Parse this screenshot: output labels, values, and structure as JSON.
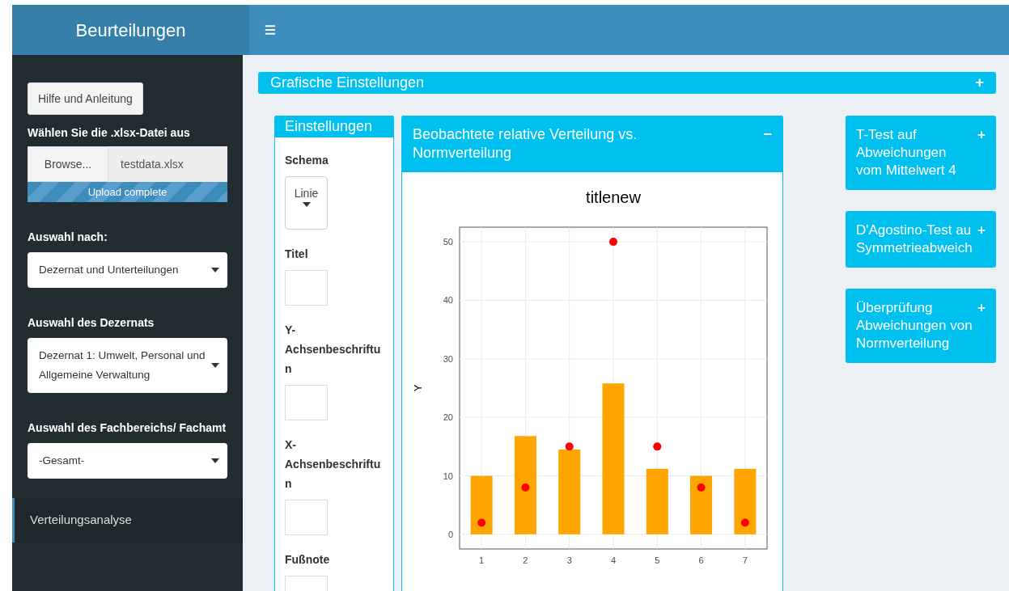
{
  "header": {
    "title": "Beurteilungen"
  },
  "sidebar": {
    "help_button": "Hilfe und Anleitung",
    "file_input": {
      "label": "Wählen Sie die .xlsx-Datei aus",
      "button": "Browse...",
      "value": "testdata.xlsx",
      "progress": {
        "label": "Upload complete",
        "level": 1
      }
    },
    "selects": [
      {
        "label": "Auswahl nach:",
        "value": "Dezernat und Unterteilungen"
      },
      {
        "label": "Auswahl des Dezernats",
        "value": "Dezernat 1: Umwelt, Personal und Allgemeine Verwaltung"
      },
      {
        "label": "Auswahl des Fachbereichs/ Fachamt",
        "value": "-Gesamt-"
      }
    ],
    "menu_items": [
      {
        "label": "Verteilungsanalyse",
        "selected": true
      }
    ]
  },
  "graphics_box": {
    "title": "Grafische Einstellungen",
    "toggle": "+",
    "expanded": false
  },
  "settings_panel": {
    "title": "Einstellungen",
    "fields": [
      {
        "kind": "select",
        "label": "Schema",
        "value": "Linie"
      },
      {
        "kind": "text",
        "label": "Titel"
      },
      {
        "kind": "text",
        "label": "Y-Achsenbeschriftun"
      },
      {
        "kind": "text",
        "label": "X-Achsenbeschriftun"
      },
      {
        "kind": "text",
        "label": "Fußnote"
      }
    ]
  },
  "chart_panel": {
    "title": "Beobachtete relative Verteilung vs. Normverteilung",
    "toggle": "−",
    "expanded": true,
    "chart_data": {
      "type": "bar",
      "title": "titlenew",
      "ylabel": "Y",
      "categories": [
        "1",
        "2",
        "3",
        "4",
        "5",
        "6",
        "7"
      ],
      "ylim": [
        -2.5,
        52.5
      ],
      "yticks": [
        0,
        10,
        20,
        30,
        40,
        50
      ],
      "grid": true,
      "series": [
        {
          "type": "bar",
          "color": "#ffa500",
          "values": [
            10,
            16.8,
            14.5,
            25.8,
            11.2,
            10,
            11.2
          ]
        },
        {
          "type": "scatter",
          "color": "#ff0000",
          "values": [
            2,
            8,
            15,
            50,
            15,
            8,
            2
          ]
        }
      ]
    }
  },
  "test_boxes": [
    {
      "title": "T-Test auf Abweichungen vom Mittelwert 4",
      "toggle": "+"
    },
    {
      "title": "D'Agostino-Test au Symmetrieabweich",
      "toggle": "+"
    },
    {
      "title": "Überprüfung Abweichungen von Normverteilung",
      "toggle": "+"
    }
  ]
}
